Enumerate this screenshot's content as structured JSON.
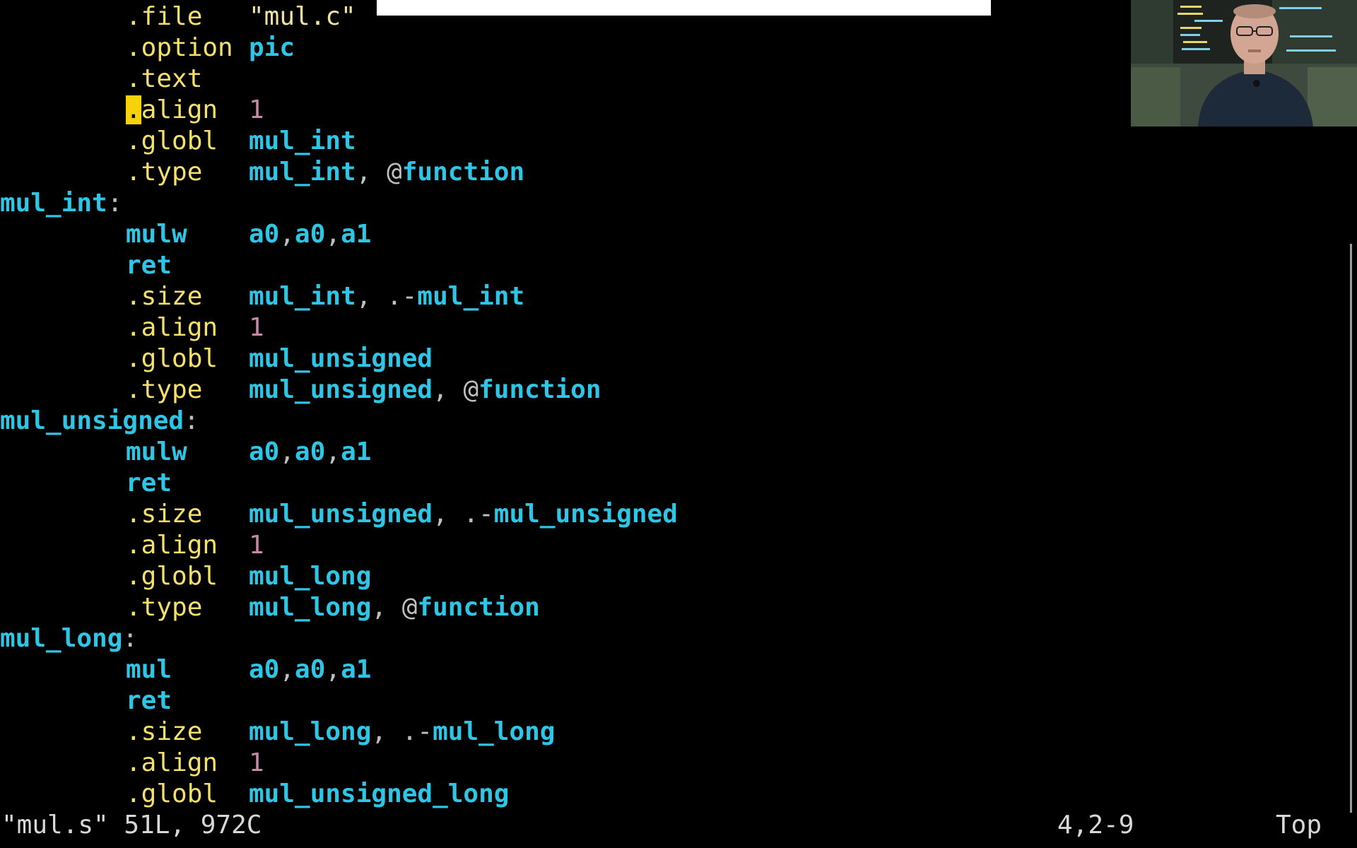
{
  "editor": {
    "lines": [
      {
        "kind": "directive",
        "directive": ".file",
        "args": [
          {
            "t": "\"mul.c\"",
            "c": "str"
          }
        ]
      },
      {
        "kind": "directive",
        "directive": ".option",
        "args": [
          {
            "t": "pic",
            "c": "sym"
          }
        ]
      },
      {
        "kind": "directive",
        "directive": ".text",
        "args": []
      },
      {
        "kind": "directive",
        "directive": ".align",
        "cursor": true,
        "args": [
          {
            "t": "1",
            "c": "num"
          }
        ]
      },
      {
        "kind": "directive",
        "directive": ".globl",
        "args": [
          {
            "t": "mul_int",
            "c": "sym"
          }
        ]
      },
      {
        "kind": "directive",
        "directive": ".type",
        "args": [
          {
            "t": "mul_int",
            "c": "sym"
          },
          {
            "t": ", @",
            "c": "pun"
          },
          {
            "t": "function",
            "c": "sym"
          }
        ]
      },
      {
        "kind": "label",
        "label": "mul_int",
        "colon": ":"
      },
      {
        "kind": "instruction",
        "directive": "mulw",
        "args": [
          {
            "t": "a0",
            "c": "sym"
          },
          {
            "t": ",",
            "c": "pun"
          },
          {
            "t": "a0",
            "c": "sym"
          },
          {
            "t": ",",
            "c": "pun"
          },
          {
            "t": "a1",
            "c": "sym"
          }
        ]
      },
      {
        "kind": "instruction",
        "directive": "ret",
        "args": []
      },
      {
        "kind": "directive",
        "directive": ".size",
        "args": [
          {
            "t": "mul_int",
            "c": "sym"
          },
          {
            "t": ", .-",
            "c": "pun"
          },
          {
            "t": "mul_int",
            "c": "sym"
          }
        ]
      },
      {
        "kind": "directive",
        "directive": ".align",
        "args": [
          {
            "t": "1",
            "c": "num"
          }
        ]
      },
      {
        "kind": "directive",
        "directive": ".globl",
        "args": [
          {
            "t": "mul_unsigned",
            "c": "sym"
          }
        ]
      },
      {
        "kind": "directive",
        "directive": ".type",
        "args": [
          {
            "t": "mul_unsigned",
            "c": "sym"
          },
          {
            "t": ", @",
            "c": "pun"
          },
          {
            "t": "function",
            "c": "sym"
          }
        ]
      },
      {
        "kind": "label",
        "label": "mul_unsigned",
        "colon": ":"
      },
      {
        "kind": "instruction",
        "directive": "mulw",
        "args": [
          {
            "t": "a0",
            "c": "sym"
          },
          {
            "t": ",",
            "c": "pun"
          },
          {
            "t": "a0",
            "c": "sym"
          },
          {
            "t": ",",
            "c": "pun"
          },
          {
            "t": "a1",
            "c": "sym"
          }
        ]
      },
      {
        "kind": "instruction",
        "directive": "ret",
        "args": []
      },
      {
        "kind": "directive",
        "directive": ".size",
        "args": [
          {
            "t": "mul_unsigned",
            "c": "sym"
          },
          {
            "t": ", .-",
            "c": "pun"
          },
          {
            "t": "mul_unsigned",
            "c": "sym"
          }
        ]
      },
      {
        "kind": "directive",
        "directive": ".align",
        "args": [
          {
            "t": "1",
            "c": "num"
          }
        ]
      },
      {
        "kind": "directive",
        "directive": ".globl",
        "args": [
          {
            "t": "mul_long",
            "c": "sym"
          }
        ]
      },
      {
        "kind": "directive",
        "directive": ".type",
        "args": [
          {
            "t": "mul_long",
            "c": "sym"
          },
          {
            "t": ", @",
            "c": "pun"
          },
          {
            "t": "function",
            "c": "sym"
          }
        ]
      },
      {
        "kind": "label",
        "label": "mul_long",
        "colon": ":"
      },
      {
        "kind": "instruction",
        "directive": "mul",
        "args": [
          {
            "t": "a0",
            "c": "sym"
          },
          {
            "t": ",",
            "c": "pun"
          },
          {
            "t": "a0",
            "c": "sym"
          },
          {
            "t": ",",
            "c": "pun"
          },
          {
            "t": "a1",
            "c": "sym"
          }
        ]
      },
      {
        "kind": "instruction",
        "directive": "ret",
        "args": []
      },
      {
        "kind": "directive",
        "directive": ".size",
        "args": [
          {
            "t": "mul_long",
            "c": "sym"
          },
          {
            "t": ", .-",
            "c": "pun"
          },
          {
            "t": "mul_long",
            "c": "sym"
          }
        ]
      },
      {
        "kind": "directive",
        "directive": ".align",
        "args": [
          {
            "t": "1",
            "c": "num"
          }
        ]
      },
      {
        "kind": "directive",
        "directive": ".globl",
        "args": [
          {
            "t": "mul_unsigned_long",
            "c": "sym"
          }
        ]
      }
    ]
  },
  "status": {
    "file_info": "\"mul.s\" 51L, 972C",
    "cursor_position": "4,2-9",
    "scroll_position": "Top"
  },
  "webcam": {
    "icon": "presenter-webcam-icon"
  },
  "colors": {
    "background": "#000000",
    "directive": "#f5e06b",
    "symbol": "#2ec6e6",
    "number": "#c58aa8",
    "cursor": "#f5d20a",
    "status_text": "#d8d8d8"
  }
}
